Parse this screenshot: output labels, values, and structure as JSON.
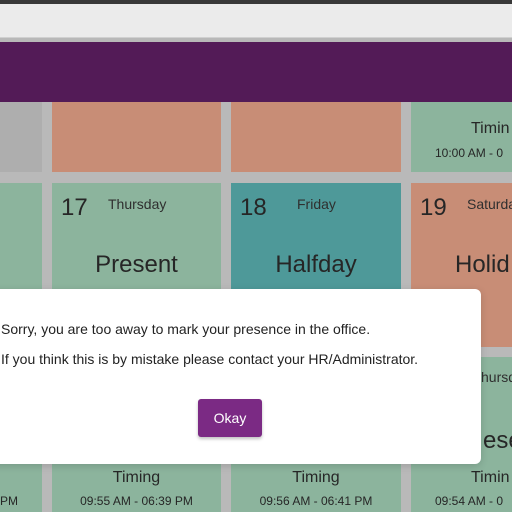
{
  "calendar": {
    "row1": {
      "card3": {
        "timing_label": "Timin",
        "timing_value": "10:00 AM  -  0"
      }
    },
    "row2": {
      "card1": {
        "date": "17",
        "day": "Thursday",
        "status": "Present"
      },
      "card2": {
        "date": "18",
        "day": "Friday",
        "status": "Halfday"
      },
      "card3": {
        "date": "19",
        "day": "Saturda",
        "status": "Holid"
      }
    },
    "row3": {
      "card3_day": "hursda",
      "card3_status": "ese"
    },
    "row4": {
      "card0": {
        "timing_value": "PM"
      },
      "card1": {
        "timing_label": "Timing",
        "timing_value": "09:55 AM  -  06:39 PM"
      },
      "card2": {
        "timing_label": "Timing",
        "timing_value": "09:56 AM  -  06:41 PM"
      },
      "card3": {
        "timing_label": "Timin",
        "timing_value": "09:54 AM  -  0"
      }
    }
  },
  "dialog": {
    "message_line1": "Sorry, you are too away to mark your presence in the office.",
    "message_line2": "If you think this is by mistake please contact your HR/Administrator.",
    "okay_label": "Okay"
  },
  "colors": {
    "header": "#5b1e5f",
    "button": "#7b2a84",
    "present": "#98c4ab",
    "holiday": "#d99a80",
    "halfday": "#55a7a6"
  }
}
